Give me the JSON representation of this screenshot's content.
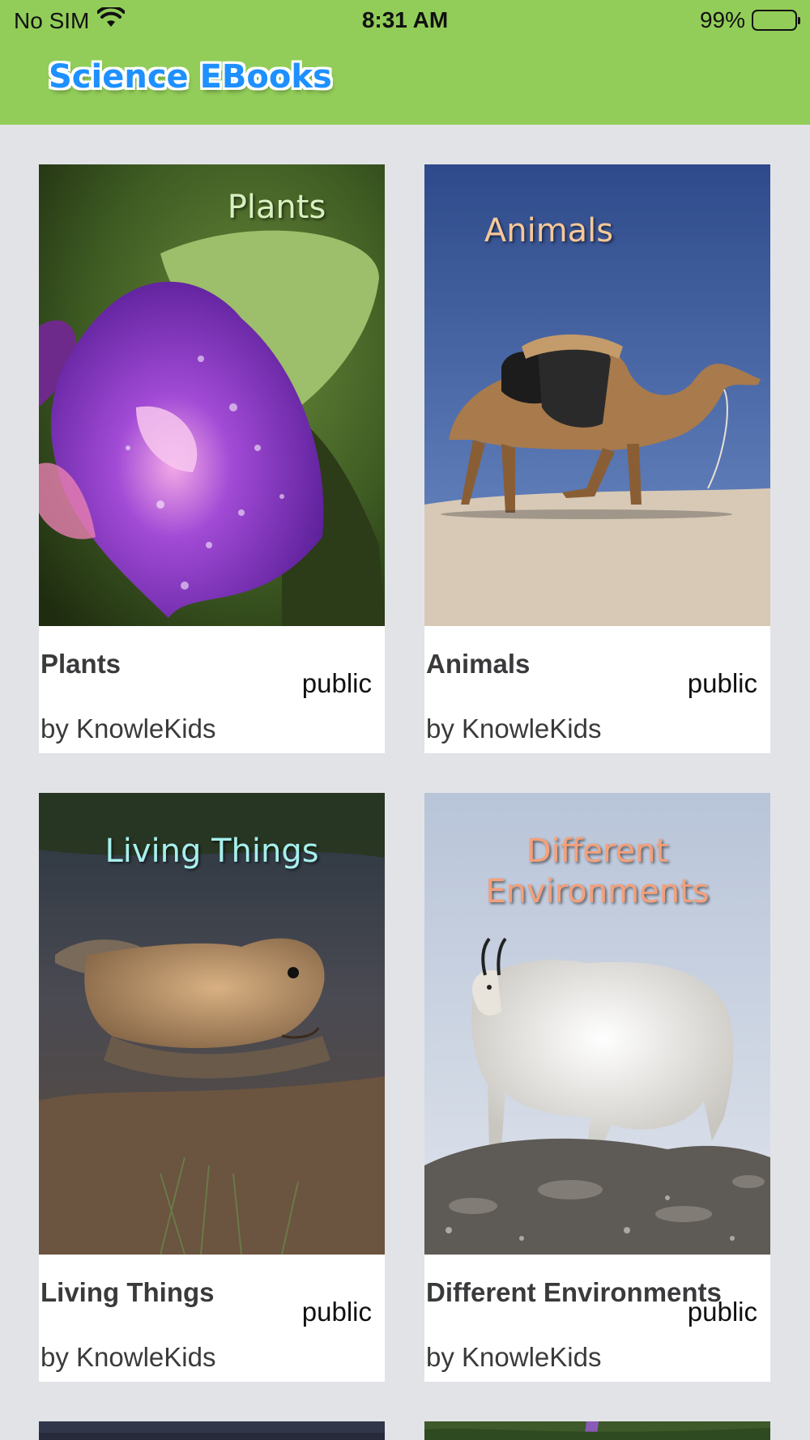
{
  "status_bar": {
    "carrier": "No SIM",
    "time": "8:31 AM",
    "battery": "99%",
    "battery_level": 0.99
  },
  "header": {
    "app_title": "Science EBooks"
  },
  "books": [
    {
      "title": "Plants",
      "cover_title": "Plants",
      "visibility": "public",
      "author": "by KnowleKids",
      "cover_title_color": "#d8f0c0"
    },
    {
      "title": "Animals",
      "cover_title": "Animals",
      "visibility": "public",
      "author": "by KnowleKids",
      "cover_title_color": "#f6c89a"
    },
    {
      "title": "Living Things",
      "cover_title": "Living Things",
      "visibility": "public",
      "author": "by KnowleKids",
      "cover_title_color": "#a6f0ee"
    },
    {
      "title": "Different Environments",
      "cover_title_line1": "Different",
      "cover_title_line2": "Environments",
      "visibility": "public",
      "author": "by KnowleKids",
      "cover_title_color": "#f5a07a"
    }
  ],
  "colors": {
    "header_bg": "#92cd59",
    "page_bg": "#e2e3e7",
    "logo_blue": "#1e90ff"
  }
}
